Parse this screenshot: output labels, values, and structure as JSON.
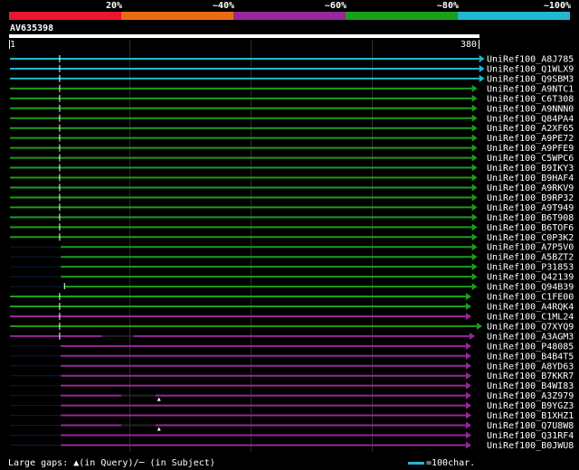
{
  "legend": {
    "labels": [
      "20%",
      "~40%",
      "~60%",
      "~80%",
      "~100%"
    ],
    "colors": [
      "#e8162e",
      "#ea6b12",
      "#962896",
      "#1b9e1b",
      "#22b7cf"
    ]
  },
  "query": {
    "name": "AV635398",
    "start": "1",
    "end": "380",
    "length": 380
  },
  "gridlines": [
    100,
    200,
    300
  ],
  "hits": [
    {
      "name": "UniRef100_A8J785",
      "color": "#22b7cf",
      "start": 1,
      "end": 392,
      "qstart": 42
    },
    {
      "name": "UniRef100_Q1WLX9",
      "color": "#22b7cf",
      "start": 1,
      "end": 392,
      "qstart": 42
    },
    {
      "name": "UniRef100_Q9SBM3",
      "color": "#22b7cf",
      "start": 1,
      "end": 392,
      "qstart": 42
    },
    {
      "name": "UniRef100_A9NTC1",
      "color": "#1b9e1b",
      "start": 1,
      "end": 386,
      "qstart": 42
    },
    {
      "name": "UniRef100_C6T308",
      "color": "#1b9e1b",
      "start": 1,
      "end": 386,
      "qstart": 42
    },
    {
      "name": "UniRef100_A9NNN0",
      "color": "#1b9e1b",
      "start": 1,
      "end": 386,
      "qstart": 42
    },
    {
      "name": "UniRef100_Q84PA4",
      "color": "#1b9e1b",
      "start": 1,
      "end": 386,
      "qstart": 42
    },
    {
      "name": "UniRef100_A2XF65",
      "color": "#1b9e1b",
      "start": 1,
      "end": 386,
      "qstart": 42
    },
    {
      "name": "UniRef100_A9PE72",
      "color": "#1b9e1b",
      "start": 1,
      "end": 386,
      "qstart": 42
    },
    {
      "name": "UniRef100_A9PFE9",
      "color": "#1b9e1b",
      "start": 1,
      "end": 386,
      "qstart": 42
    },
    {
      "name": "UniRef100_C5WPC6",
      "color": "#1b9e1b",
      "start": 1,
      "end": 386,
      "qstart": 42
    },
    {
      "name": "UniRef100_B9IKY3",
      "color": "#1b9e1b",
      "start": 1,
      "end": 386,
      "qstart": 42
    },
    {
      "name": "UniRef100_B9HAF4",
      "color": "#1b9e1b",
      "start": 1,
      "end": 386,
      "qstart": 42
    },
    {
      "name": "UniRef100_A9RKV9",
      "color": "#1b9e1b",
      "start": 1,
      "end": 386,
      "qstart": 42
    },
    {
      "name": "UniRef100_B9RP32",
      "color": "#1b9e1b",
      "start": 1,
      "end": 386,
      "qstart": 42
    },
    {
      "name": "UniRef100_A9T949",
      "color": "#1b9e1b",
      "start": 1,
      "end": 386,
      "qstart": 42
    },
    {
      "name": "UniRef100_B6T908",
      "color": "#1b9e1b",
      "start": 1,
      "end": 386,
      "qstart": 42
    },
    {
      "name": "UniRef100_B6TOF6",
      "color": "#1b9e1b",
      "start": 1,
      "end": 386,
      "qstart": 42
    },
    {
      "name": "UniRef100_C0P3K2",
      "color": "#1b9e1b",
      "start": 1,
      "end": 386,
      "qstart": 42
    },
    {
      "name": "UniRef100_A7P5V0",
      "color": "#1b9e1b",
      "start": 43,
      "end": 386
    },
    {
      "name": "UniRef100_A5BZT2",
      "color": "#1b9e1b",
      "start": 43,
      "end": 386
    },
    {
      "name": "UniRef100_P31853",
      "color": "#1b9e1b",
      "start": 43,
      "end": 386
    },
    {
      "name": "UniRef100_Q42139",
      "color": "#1b9e1b",
      "start": 43,
      "end": 386
    },
    {
      "name": "UniRef100_Q94B39",
      "color": "#1b9e1b",
      "start": 46,
      "end": 386
    },
    {
      "name": "UniRef100_C1FE00",
      "color": "#1b9e1b",
      "start": 1,
      "end": 381,
      "qstart": 42
    },
    {
      "name": "UniRef100_A4RQK4",
      "color": "#1b9e1b",
      "start": 1,
      "end": 381,
      "qstart": 42
    },
    {
      "name": "UniRef100_C1ML24",
      "color": "#962896",
      "start": 1,
      "end": 381,
      "qstart": 42
    },
    {
      "name": "UniRef100_Q7XYQ9",
      "color": "#1b9e1b",
      "start": 1,
      "end": 390,
      "qstart": 42
    },
    {
      "name": "UniRef100_A3AGM3",
      "color": "#962896",
      "start": 1,
      "end": 384,
      "qstart": 42,
      "gap": [
        77,
        103
      ]
    },
    {
      "name": "UniRef100_P48085",
      "color": "#962896",
      "start": 43,
      "end": 381
    },
    {
      "name": "UniRef100_B4B4T5",
      "color": "#962896",
      "start": 43,
      "end": 381
    },
    {
      "name": "UniRef100_A8YD63",
      "color": "#962896",
      "start": 43,
      "end": 381
    },
    {
      "name": "UniRef100_B7KKR7",
      "color": "#962896",
      "start": 43,
      "end": 381
    },
    {
      "name": "UniRef100_B4WI83",
      "color": "#962896",
      "start": 43,
      "end": 381
    },
    {
      "name": "UniRef100_A3Z979",
      "color": "#962896",
      "start": 43,
      "end": 381,
      "gap": [
        93,
        121
      ],
      "mark": 124
    },
    {
      "name": "UniRef100_B9YGZ3",
      "color": "#962896",
      "start": 43,
      "end": 381
    },
    {
      "name": "UniRef100_B1XHZ1",
      "color": "#962896",
      "start": 43,
      "end": 381
    },
    {
      "name": "UniRef100_Q7U8W8",
      "color": "#962896",
      "start": 43,
      "end": 381,
      "gap": [
        93,
        121
      ],
      "mark": 124
    },
    {
      "name": "UniRef100_Q31RF4",
      "color": "#962896",
      "start": 43,
      "end": 381
    },
    {
      "name": "UniRef100_B0JWU8",
      "color": "#962896",
      "start": 43,
      "end": 381
    }
  ],
  "footer": {
    "text": "Large gaps: ▲(in Query)/─ (in Subject)",
    "scale_text": "=100char.",
    "scale_color": "#22b7cf"
  }
}
